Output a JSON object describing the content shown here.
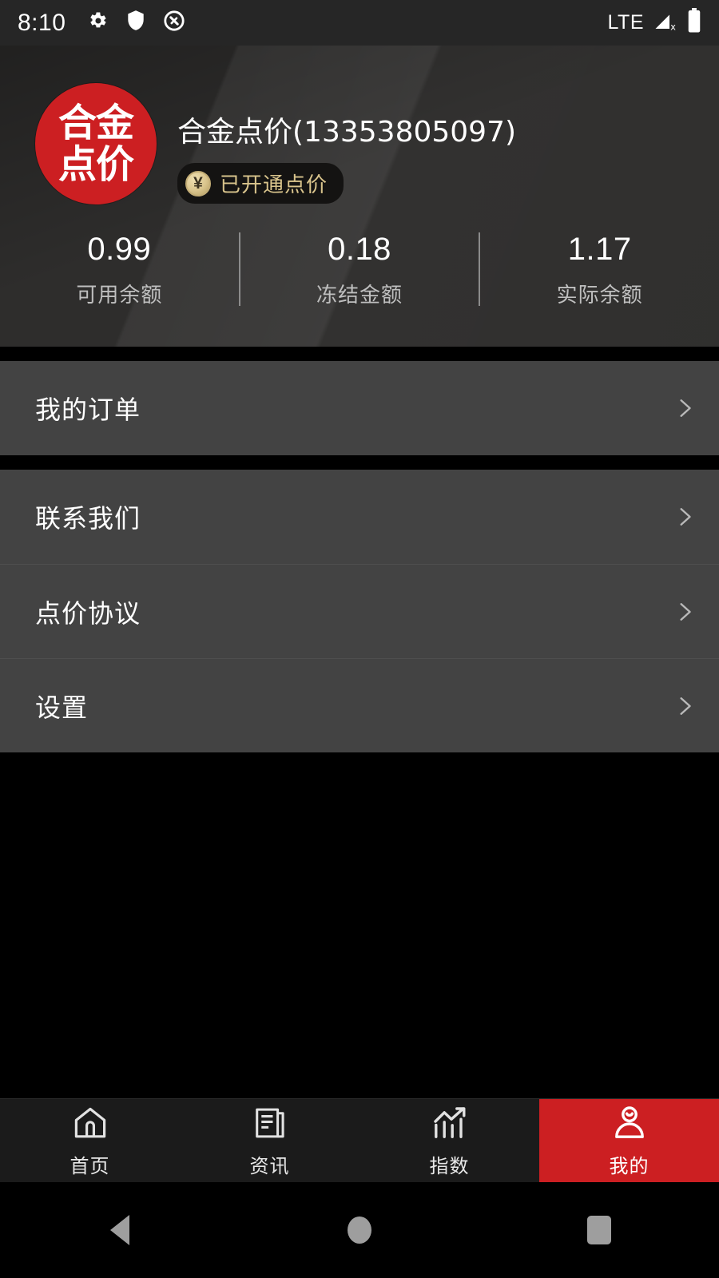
{
  "status_bar": {
    "time": "8:10",
    "network": "LTE",
    "left_icons": [
      "gear-icon",
      "shield-icon",
      "do-not-disturb-icon"
    ],
    "right_icons": [
      "signal-off-icon",
      "battery-full-icon"
    ]
  },
  "header": {
    "logo_lines": [
      "合金",
      "点价"
    ],
    "account_name": "合金点价(13353805097)",
    "badge": {
      "icon": "yen-coin-icon",
      "symbol": "¥",
      "text": "已开通点价"
    },
    "balances": [
      {
        "value": "0.99",
        "label": "可用余额"
      },
      {
        "value": "0.18",
        "label": "冻结金额"
      },
      {
        "value": "1.17",
        "label": "实际余额"
      }
    ]
  },
  "menu_groups": [
    {
      "items": [
        {
          "label": "我的订单"
        }
      ]
    },
    {
      "items": [
        {
          "label": "联系我们"
        },
        {
          "label": "点价协议"
        },
        {
          "label": "设置"
        }
      ]
    }
  ],
  "tabbar": [
    {
      "label": "首页",
      "icon": "home-icon",
      "active": false
    },
    {
      "label": "资讯",
      "icon": "news-document-icon",
      "active": false
    },
    {
      "label": "指数",
      "icon": "chart-trending-icon",
      "active": false
    },
    {
      "label": "我的",
      "icon": "person-icon",
      "active": true
    }
  ],
  "android_nav": {
    "back": "back-triangle-icon",
    "home": "home-circle-icon",
    "recents": "recents-square-icon"
  },
  "colors": {
    "accent_red": "#cc1f22",
    "header_bg": "#2e2d2c",
    "menu_bg": "#434343",
    "badge_gold": "#d9c48c"
  }
}
